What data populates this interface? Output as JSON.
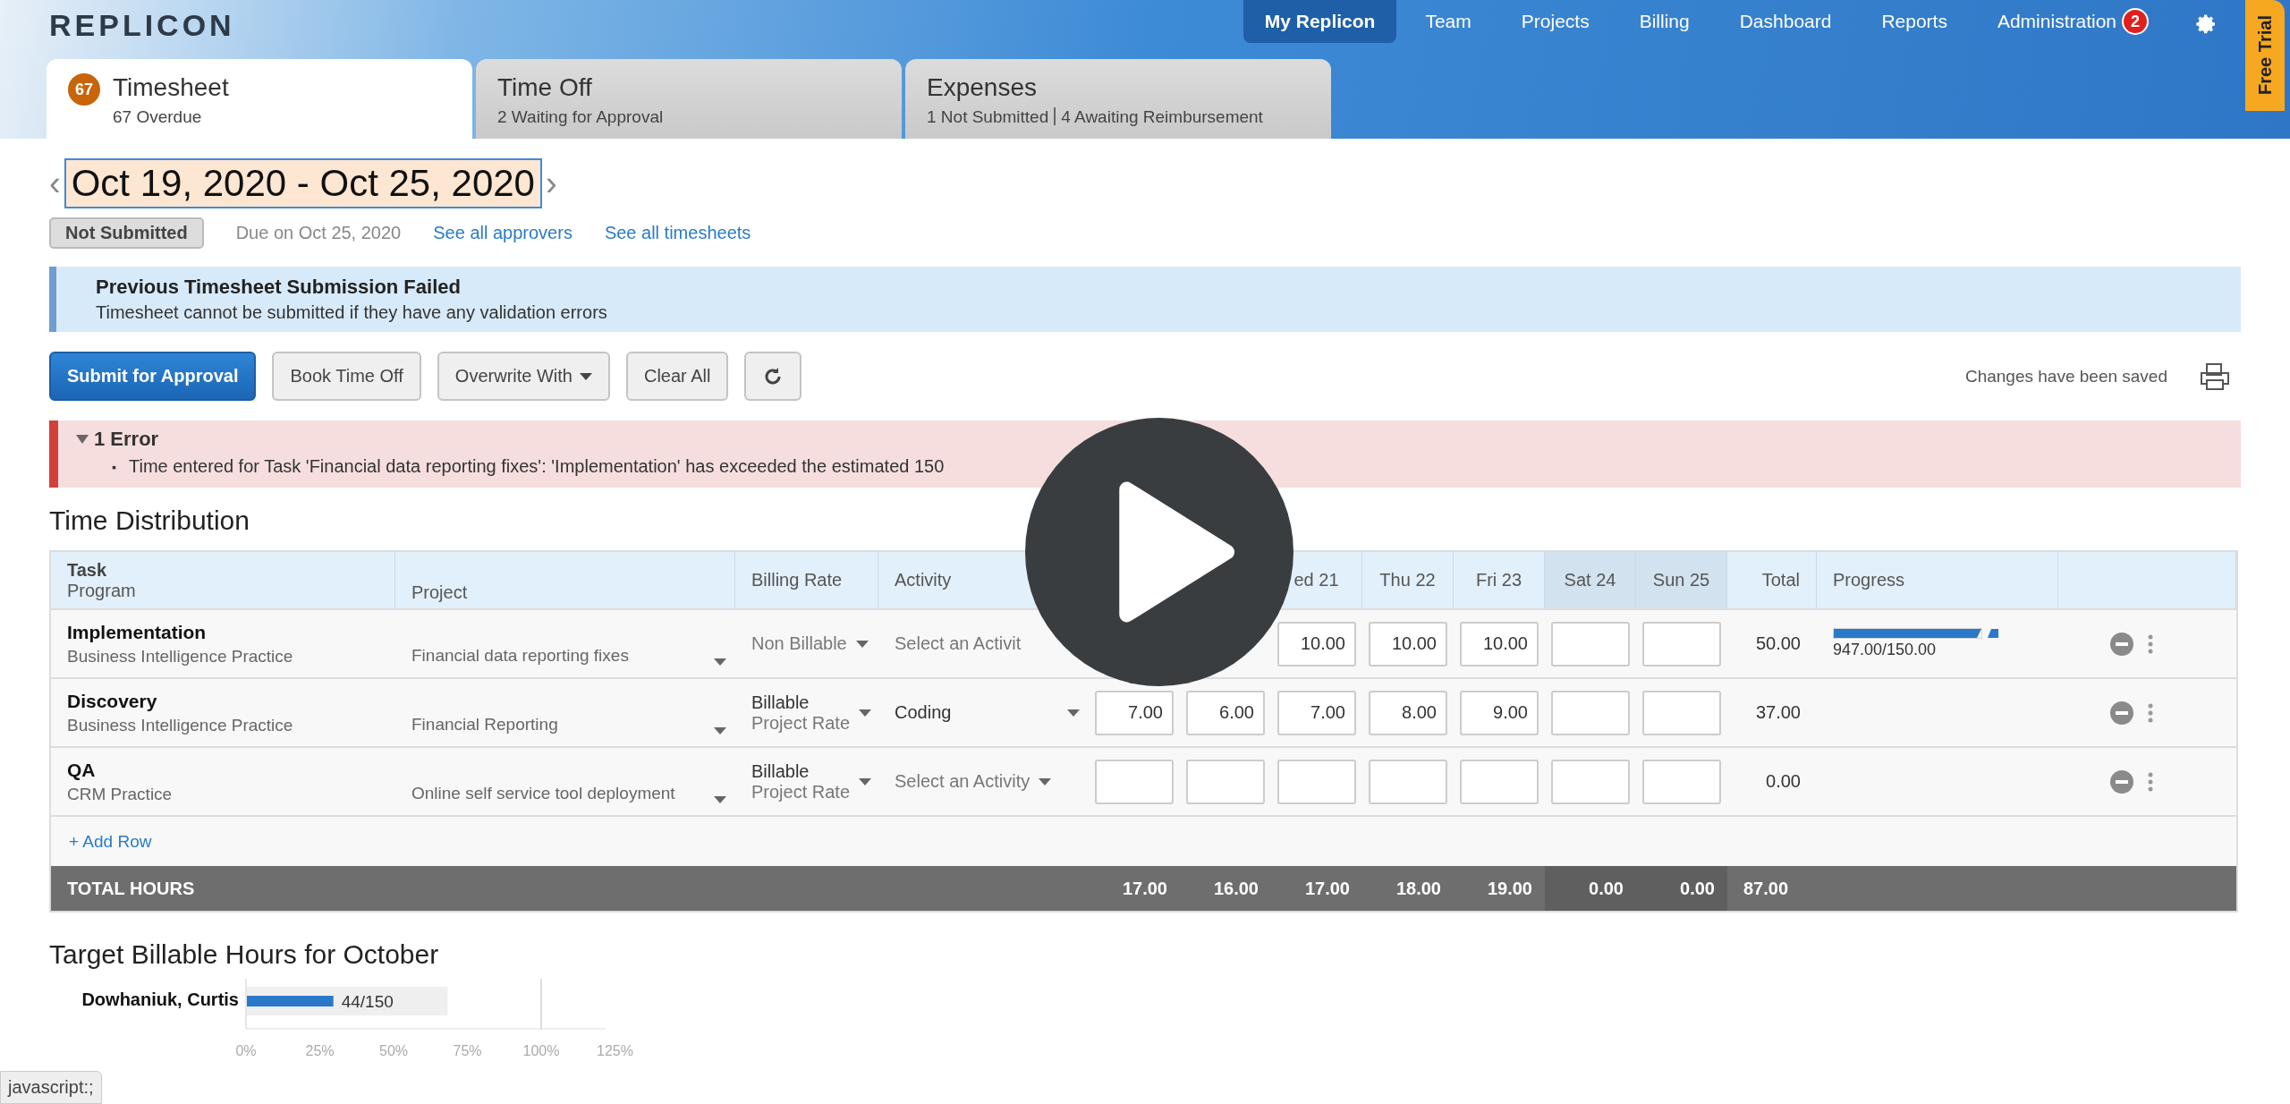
{
  "header": {
    "logo": "REPLICON",
    "nav": [
      {
        "label": "My Replicon",
        "selected": true
      },
      {
        "label": "Team",
        "selected": false
      },
      {
        "label": "Projects",
        "selected": false
      },
      {
        "label": "Billing",
        "selected": false
      },
      {
        "label": "Dashboard",
        "selected": false
      },
      {
        "label": "Reports",
        "selected": false
      },
      {
        "label": "Administration",
        "selected": false,
        "badge": "2"
      }
    ],
    "free_trial": "Free Trial"
  },
  "tabs": [
    {
      "title": "Timesheet",
      "badge": "67",
      "subtitle": [
        "67 Overdue"
      ],
      "selected": true
    },
    {
      "title": "Time Off",
      "subtitle": [
        "2 Waiting for Approval"
      ],
      "selected": false
    },
    {
      "title": "Expenses",
      "subtitle": [
        "1 Not Submitted",
        "4 Awaiting Reimbursement"
      ],
      "selected": false
    }
  ],
  "period": {
    "prev": "‹",
    "range": "Oct 19, 2020 - Oct 25, 2020",
    "next": "›",
    "status": "Not Submitted",
    "due": "Due on Oct 25, 2020",
    "links": [
      "See all approvers",
      "See all timesheets"
    ]
  },
  "notice": {
    "title": "Previous Timesheet Submission Failed",
    "message": "Timesheet cannot be submitted if they have any validation errors"
  },
  "toolbar": {
    "buttons": [
      {
        "label": "Submit for Approval",
        "kind": "primary"
      },
      {
        "label": "Book Time Off",
        "kind": "plain"
      },
      {
        "label": "Overwrite With",
        "kind": "dropdown"
      },
      {
        "label": "Clear All",
        "kind": "plain"
      },
      {
        "kind": "refresh"
      }
    ],
    "save_status": "Changes have been saved"
  },
  "errors": {
    "title": "1 Error",
    "expanded": true,
    "items": [
      {
        "bullet": "▪",
        "text": "Time entered for Task 'Financial data reporting fixes': 'Implementation' has exceeded the estimated 150"
      }
    ]
  },
  "section_title": "Time Distribution",
  "table": {
    "columns": {
      "task": "Task",
      "program": "Program",
      "project": "Project",
      "billing": "Billing Rate",
      "activity": "Activity",
      "days": [
        {
          "label": "ed 21",
          "weekend": false
        },
        {
          "label": "Thu 22",
          "weekend": false
        },
        {
          "label": "Fri 23",
          "weekend": false
        },
        {
          "label": "Sat 24",
          "weekend": true
        },
        {
          "label": "Sun 25",
          "weekend": true
        }
      ],
      "total": "Total",
      "progress": "Progress"
    },
    "rows": [
      {
        "task": "Implementation",
        "program": "Business Intelligence Practice",
        "project": "Financial data reporting fixes",
        "billing": [
          "Non Billable"
        ],
        "activity": "Select an Activit",
        "activity_selected": false,
        "activity_caret": false,
        "hours": [
          {
            "kind": "covered"
          },
          {
            "kind": "covered"
          },
          {
            "kind": "entry",
            "value": "10.00"
          },
          {
            "kind": "entry",
            "value": "10.00"
          },
          {
            "kind": "entry",
            "value": "10.00"
          },
          {
            "kind": "blank"
          },
          {
            "kind": "blank"
          }
        ],
        "total": "50.00",
        "progress": {
          "level": 1,
          "label": "947.00/150.00"
        }
      },
      {
        "task": "Discovery",
        "program": "Business Intelligence Practice",
        "project": "Financial Reporting",
        "billing": [
          "Billable",
          "Project Rate"
        ],
        "activity": "Coding",
        "activity_selected": true,
        "activity_caret": true,
        "hours": [
          {
            "kind": "entry",
            "value": "7.00"
          },
          {
            "kind": "entry",
            "value": "6.00"
          },
          {
            "kind": "entry",
            "value": "7.00"
          },
          {
            "kind": "entry",
            "value": "8.00"
          },
          {
            "kind": "entry",
            "value": "9.00"
          },
          {
            "kind": "blank"
          },
          {
            "kind": "blank"
          }
        ],
        "total": "37.00"
      },
      {
        "task": "QA",
        "program": "CRM Practice",
        "project": "Online self service tool deployment",
        "billing": [
          "Billable",
          "Project Rate"
        ],
        "activity": "Select an Activity",
        "activity_selected": false,
        "activity_caret": true,
        "hours": [
          {
            "kind": "blank"
          },
          {
            "kind": "blank"
          },
          {
            "kind": "blank"
          },
          {
            "kind": "blank"
          },
          {
            "kind": "blank"
          },
          {
            "kind": "blank"
          },
          {
            "kind": "blank"
          }
        ],
        "total": "0.00"
      }
    ],
    "add_row": "+ Add Row",
    "footer": {
      "label": "TOTAL HOURS",
      "days": [
        "17.00",
        "16.00",
        "17.00",
        "18.00",
        "19.00",
        "0.00",
        "0.00"
      ],
      "total": "87.00"
    }
  },
  "target": {
    "title": "Target Billable Hours for October",
    "chart_data": {
      "type": "bar",
      "orientation": "horizontal",
      "categories": [
        "Dowhaniuk, Curtis"
      ],
      "series": [
        {
          "color": "#efefef",
          "values": [
            0.68
          ]
        },
        {
          "color": "#2a79c9",
          "values": [
            0.293
          ]
        }
      ],
      "xlim": [
        0,
        1.25
      ],
      "xticks": [
        {
          "value": 0,
          "label": "0%"
        },
        {
          "value": 0.25,
          "label": "25%"
        },
        {
          "value": 0.5,
          "label": "50%"
        },
        {
          "value": 0.75,
          "label": "75%"
        },
        {
          "value": 1,
          "label": "100%"
        },
        {
          "value": 1.25,
          "label": "125%"
        }
      ],
      "value_labels": [
        "44/150"
      ],
      "ref_lines": [
        {
          "value": 1,
          "axis": "x"
        }
      ]
    }
  },
  "status_bar": "javascript:;"
}
